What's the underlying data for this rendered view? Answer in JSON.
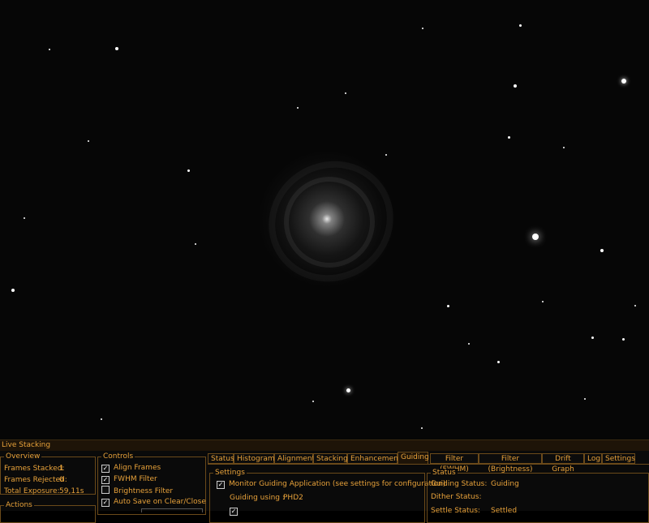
{
  "window": {
    "title": "Live Stacking"
  },
  "overview": {
    "title": "Overview",
    "frames_stacked_label": "Frames Stacked:",
    "frames_stacked_value": "1",
    "frames_rejected_label": "Frames Rejected:",
    "frames_rejected_value": "0",
    "total_exposure_label": "Total Exposure:",
    "total_exposure_value": "59,11s"
  },
  "actions": {
    "title": "Actions"
  },
  "controls": {
    "title": "Controls",
    "items": [
      {
        "label": "Align Frames",
        "checked": true
      },
      {
        "label": "FWHM Filter",
        "checked": true
      },
      {
        "label": "Brightness Filter",
        "checked": false
      },
      {
        "label": "Auto Save on Clear/Close",
        "checked": true
      }
    ]
  },
  "tabs": [
    {
      "label": "Status",
      "active": false
    },
    {
      "label": "Histogram",
      "active": false
    },
    {
      "label": "Alignment",
      "active": false
    },
    {
      "label": "Stacking",
      "active": false
    },
    {
      "label": "Enhancement",
      "active": false
    },
    {
      "label": "Guiding",
      "active": true
    },
    {
      "label": "Filter (FWHM)",
      "active": false
    },
    {
      "label": "Filter (Brightness)",
      "active": false
    },
    {
      "label": "Drift Graph",
      "active": false
    },
    {
      "label": "Log",
      "active": false
    },
    {
      "label": "Settings",
      "active": false
    }
  ],
  "guiding_settings": {
    "title": "Settings",
    "monitor_label": "Monitor Guiding Application (see settings for configuration)",
    "monitor_checked": true,
    "guiding_using_label": "Guiding using :",
    "guiding_using_value": "PHD2"
  },
  "guiding_status": {
    "title": "Status",
    "guiding_status_label": "Guiding Status:",
    "guiding_status_value": "Guiding",
    "dither_status_label": "Dither Status:",
    "dither_status_value": "",
    "settle_status_label": "Settle Status:",
    "settle_status_value": "Settled"
  },
  "colors": {
    "accent": "#e8a23a",
    "border": "#6b4a1a",
    "background": "#0a0a0a"
  }
}
